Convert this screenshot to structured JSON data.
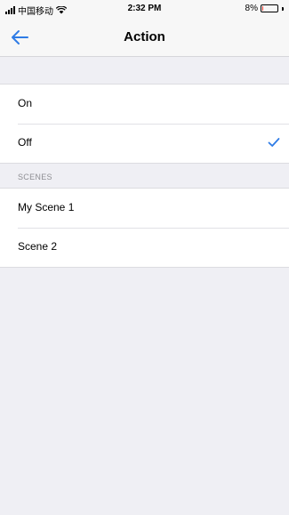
{
  "status_bar": {
    "carrier": "中国移动",
    "time": "2:32 PM",
    "battery_percent_label": "8%",
    "battery_level": 0.08,
    "icons": [
      "signal-icon",
      "wifi-icon",
      "battery-icon"
    ]
  },
  "nav": {
    "title": "Action",
    "back_icon": "arrow-left-icon"
  },
  "colors": {
    "accent": "#2f7ce6",
    "background": "#efeff4",
    "battery_low": "#ff3b30"
  },
  "actions": [
    {
      "label": "On",
      "selected": false
    },
    {
      "label": "Off",
      "selected": true
    }
  ],
  "scenes_section": {
    "header": "SCENES",
    "items": [
      {
        "label": "My Scene 1"
      },
      {
        "label": "Scene 2"
      }
    ]
  }
}
